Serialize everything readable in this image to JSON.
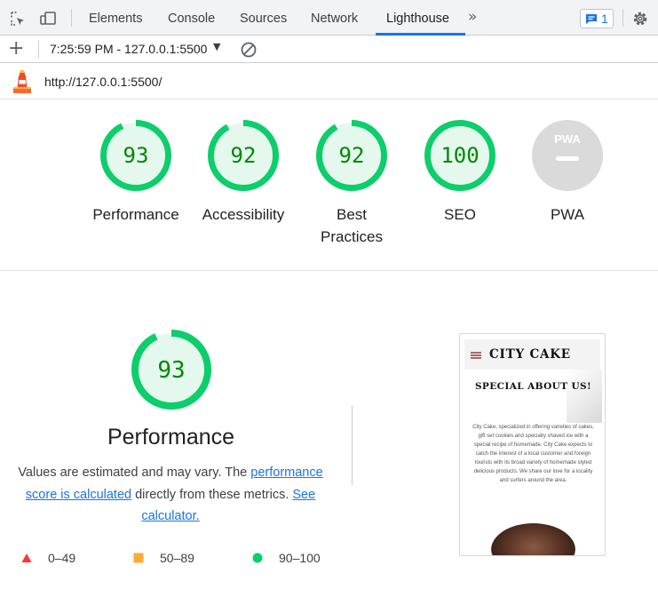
{
  "devtools": {
    "tabs": [
      {
        "label": "Elements"
      },
      {
        "label": "Console"
      },
      {
        "label": "Sources"
      },
      {
        "label": "Network"
      },
      {
        "label": "Lighthouse"
      }
    ],
    "active_tab": "Lighthouse",
    "issues_count": "1",
    "accent_color": "#1a73e8"
  },
  "toolbar": {
    "report_selector": "7:25:59 PM - 127.0.0.1:5500",
    "icons": [
      "plus-icon",
      "clear-icon",
      "caret-down-icon"
    ]
  },
  "report": {
    "url": "http://127.0.0.1:5500/",
    "gauges": [
      {
        "score": "93",
        "label": "Performance",
        "value": 93
      },
      {
        "score": "92",
        "label": "Accessibility",
        "value": 92
      },
      {
        "score": "92",
        "label": "Best Practices",
        "value": 92
      },
      {
        "score": "100",
        "label": "SEO",
        "value": 100
      },
      {
        "score": "",
        "label": "PWA",
        "badge": "PWA"
      }
    ],
    "pass_color": "#0cce6b",
    "pass_text_color": "#008800",
    "pass_fill_color": "#e5f8ee"
  },
  "performance": {
    "score": "93",
    "value": 93,
    "title": "Performance",
    "desc_prefix": "Values are estimated and may vary. The ",
    "link_score": "performance score is calculated",
    "desc_middle": " directly from these metrics. ",
    "link_calculator": "See calculator.",
    "legend": [
      {
        "range": "0–49",
        "color": "#ff3333",
        "shape": "triangle"
      },
      {
        "range": "50–89",
        "color": "#ffaa33",
        "shape": "square"
      },
      {
        "range": "90–100",
        "color": "#0cce6b",
        "shape": "circle"
      }
    ]
  },
  "screenshot": {
    "brand": "CITY CAKE",
    "heading": "SPECIAL ABOUT US!",
    "body": "City Cake, specialized in offering varieties of cakes, gift set cookies and specialty shaved ice with a special recipe of homemade. City Cake expects to catch the interest of a local customer and foreign tourists with its broad variety of homemade styled delicious products. We share our love for a locality and surfers around the area."
  }
}
